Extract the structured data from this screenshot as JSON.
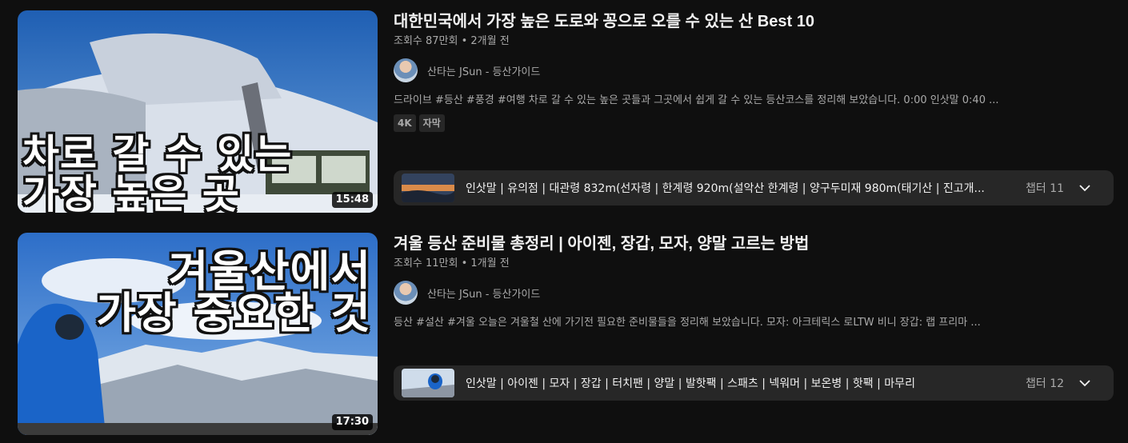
{
  "videos": [
    {
      "title": "대한민국에서 가장 높은 도로와 꽁으로 오를 수 있는 산 Best 10",
      "meta": "조회수 87만회 • 2개월 전",
      "channel": "산타는 JSun - 등산가이드",
      "description": "드라이브 #등산 #풍경 #여행 차로 갈 수 있는 높은 곳들과 그곳에서 쉽게 갈 수 있는 등산코스를 정리해 보았습니다. 0:00 인삿말 0:40 ...",
      "badges": [
        "4K",
        "자막"
      ],
      "thumb_text_line1": "차로 갈 수 있는",
      "thumb_text_line2": "가장 높은 곳",
      "duration": "15:48",
      "chapters_text": "인삿말 | 유의점 | 대관령 832m(선자령 | 한계령 920m(설악산 한계령 | 양구두미재 980m(태기산 | 진고개...",
      "chapters_count": "챕터 11"
    },
    {
      "title": "겨울 등산 준비물 총정리 | 아이젠, 장갑, 모자, 양말 고르는 방법",
      "meta": "조회수 11만회 • 1개월 전",
      "channel": "산타는 JSun - 등산가이드",
      "description": "등산 #설산 #겨울 오늘은 겨울철 산에 가기전 필요한 준비물들을 정리해 보았습니다. 모자: 아크테릭스 로LTW 비니 장갑: 랩 프리마 ...",
      "thumb_text_line1": "겨울산에서",
      "thumb_text_line2": "가장 중요한 것",
      "duration": "17:30",
      "chapters_text": "인삿말 | 아이젠 | 모자 | 장갑 | 터치팬 | 양말 | 발핫팩 | 스패츠 | 넥워머 | 보온병 | 핫팩 | 마무리",
      "chapters_count": "챕터 12"
    }
  ],
  "icons": {
    "chapters_toggle": "chevron-down-icon"
  },
  "colors": {
    "background": "#0f0f0f",
    "secondary_text": "#aaaaaa",
    "chip_bg": "#272727"
  }
}
